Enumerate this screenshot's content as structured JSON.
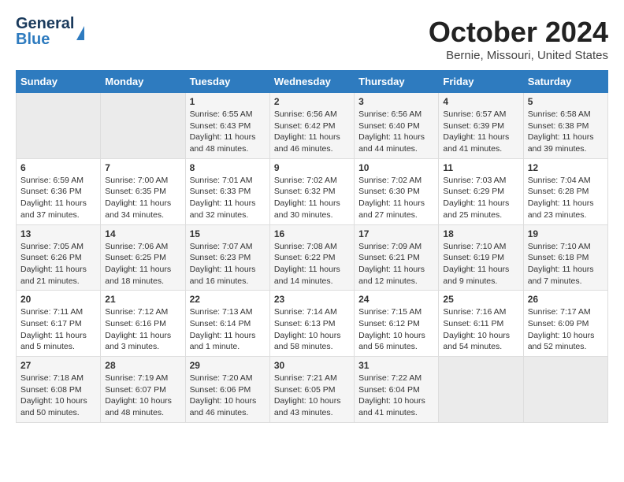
{
  "logo": {
    "general": "General",
    "blue": "Blue"
  },
  "title": "October 2024",
  "subtitle": "Bernie, Missouri, United States",
  "days_of_week": [
    "Sunday",
    "Monday",
    "Tuesday",
    "Wednesday",
    "Thursday",
    "Friday",
    "Saturday"
  ],
  "weeks": [
    [
      {
        "day": "",
        "sunrise": "",
        "sunset": "",
        "daylight": ""
      },
      {
        "day": "",
        "sunrise": "",
        "sunset": "",
        "daylight": ""
      },
      {
        "day": "1",
        "sunrise": "Sunrise: 6:55 AM",
        "sunset": "Sunset: 6:43 PM",
        "daylight": "Daylight: 11 hours and 48 minutes."
      },
      {
        "day": "2",
        "sunrise": "Sunrise: 6:56 AM",
        "sunset": "Sunset: 6:42 PM",
        "daylight": "Daylight: 11 hours and 46 minutes."
      },
      {
        "day": "3",
        "sunrise": "Sunrise: 6:56 AM",
        "sunset": "Sunset: 6:40 PM",
        "daylight": "Daylight: 11 hours and 44 minutes."
      },
      {
        "day": "4",
        "sunrise": "Sunrise: 6:57 AM",
        "sunset": "Sunset: 6:39 PM",
        "daylight": "Daylight: 11 hours and 41 minutes."
      },
      {
        "day": "5",
        "sunrise": "Sunrise: 6:58 AM",
        "sunset": "Sunset: 6:38 PM",
        "daylight": "Daylight: 11 hours and 39 minutes."
      }
    ],
    [
      {
        "day": "6",
        "sunrise": "Sunrise: 6:59 AM",
        "sunset": "Sunset: 6:36 PM",
        "daylight": "Daylight: 11 hours and 37 minutes."
      },
      {
        "day": "7",
        "sunrise": "Sunrise: 7:00 AM",
        "sunset": "Sunset: 6:35 PM",
        "daylight": "Daylight: 11 hours and 34 minutes."
      },
      {
        "day": "8",
        "sunrise": "Sunrise: 7:01 AM",
        "sunset": "Sunset: 6:33 PM",
        "daylight": "Daylight: 11 hours and 32 minutes."
      },
      {
        "day": "9",
        "sunrise": "Sunrise: 7:02 AM",
        "sunset": "Sunset: 6:32 PM",
        "daylight": "Daylight: 11 hours and 30 minutes."
      },
      {
        "day": "10",
        "sunrise": "Sunrise: 7:02 AM",
        "sunset": "Sunset: 6:30 PM",
        "daylight": "Daylight: 11 hours and 27 minutes."
      },
      {
        "day": "11",
        "sunrise": "Sunrise: 7:03 AM",
        "sunset": "Sunset: 6:29 PM",
        "daylight": "Daylight: 11 hours and 25 minutes."
      },
      {
        "day": "12",
        "sunrise": "Sunrise: 7:04 AM",
        "sunset": "Sunset: 6:28 PM",
        "daylight": "Daylight: 11 hours and 23 minutes."
      }
    ],
    [
      {
        "day": "13",
        "sunrise": "Sunrise: 7:05 AM",
        "sunset": "Sunset: 6:26 PM",
        "daylight": "Daylight: 11 hours and 21 minutes."
      },
      {
        "day": "14",
        "sunrise": "Sunrise: 7:06 AM",
        "sunset": "Sunset: 6:25 PM",
        "daylight": "Daylight: 11 hours and 18 minutes."
      },
      {
        "day": "15",
        "sunrise": "Sunrise: 7:07 AM",
        "sunset": "Sunset: 6:23 PM",
        "daylight": "Daylight: 11 hours and 16 minutes."
      },
      {
        "day": "16",
        "sunrise": "Sunrise: 7:08 AM",
        "sunset": "Sunset: 6:22 PM",
        "daylight": "Daylight: 11 hours and 14 minutes."
      },
      {
        "day": "17",
        "sunrise": "Sunrise: 7:09 AM",
        "sunset": "Sunset: 6:21 PM",
        "daylight": "Daylight: 11 hours and 12 minutes."
      },
      {
        "day": "18",
        "sunrise": "Sunrise: 7:10 AM",
        "sunset": "Sunset: 6:19 PM",
        "daylight": "Daylight: 11 hours and 9 minutes."
      },
      {
        "day": "19",
        "sunrise": "Sunrise: 7:10 AM",
        "sunset": "Sunset: 6:18 PM",
        "daylight": "Daylight: 11 hours and 7 minutes."
      }
    ],
    [
      {
        "day": "20",
        "sunrise": "Sunrise: 7:11 AM",
        "sunset": "Sunset: 6:17 PM",
        "daylight": "Daylight: 11 hours and 5 minutes."
      },
      {
        "day": "21",
        "sunrise": "Sunrise: 7:12 AM",
        "sunset": "Sunset: 6:16 PM",
        "daylight": "Daylight: 11 hours and 3 minutes."
      },
      {
        "day": "22",
        "sunrise": "Sunrise: 7:13 AM",
        "sunset": "Sunset: 6:14 PM",
        "daylight": "Daylight: 11 hours and 1 minute."
      },
      {
        "day": "23",
        "sunrise": "Sunrise: 7:14 AM",
        "sunset": "Sunset: 6:13 PM",
        "daylight": "Daylight: 10 hours and 58 minutes."
      },
      {
        "day": "24",
        "sunrise": "Sunrise: 7:15 AM",
        "sunset": "Sunset: 6:12 PM",
        "daylight": "Daylight: 10 hours and 56 minutes."
      },
      {
        "day": "25",
        "sunrise": "Sunrise: 7:16 AM",
        "sunset": "Sunset: 6:11 PM",
        "daylight": "Daylight: 10 hours and 54 minutes."
      },
      {
        "day": "26",
        "sunrise": "Sunrise: 7:17 AM",
        "sunset": "Sunset: 6:09 PM",
        "daylight": "Daylight: 10 hours and 52 minutes."
      }
    ],
    [
      {
        "day": "27",
        "sunrise": "Sunrise: 7:18 AM",
        "sunset": "Sunset: 6:08 PM",
        "daylight": "Daylight: 10 hours and 50 minutes."
      },
      {
        "day": "28",
        "sunrise": "Sunrise: 7:19 AM",
        "sunset": "Sunset: 6:07 PM",
        "daylight": "Daylight: 10 hours and 48 minutes."
      },
      {
        "day": "29",
        "sunrise": "Sunrise: 7:20 AM",
        "sunset": "Sunset: 6:06 PM",
        "daylight": "Daylight: 10 hours and 46 minutes."
      },
      {
        "day": "30",
        "sunrise": "Sunrise: 7:21 AM",
        "sunset": "Sunset: 6:05 PM",
        "daylight": "Daylight: 10 hours and 43 minutes."
      },
      {
        "day": "31",
        "sunrise": "Sunrise: 7:22 AM",
        "sunset": "Sunset: 6:04 PM",
        "daylight": "Daylight: 10 hours and 41 minutes."
      },
      {
        "day": "",
        "sunrise": "",
        "sunset": "",
        "daylight": ""
      },
      {
        "day": "",
        "sunrise": "",
        "sunset": "",
        "daylight": ""
      }
    ]
  ]
}
